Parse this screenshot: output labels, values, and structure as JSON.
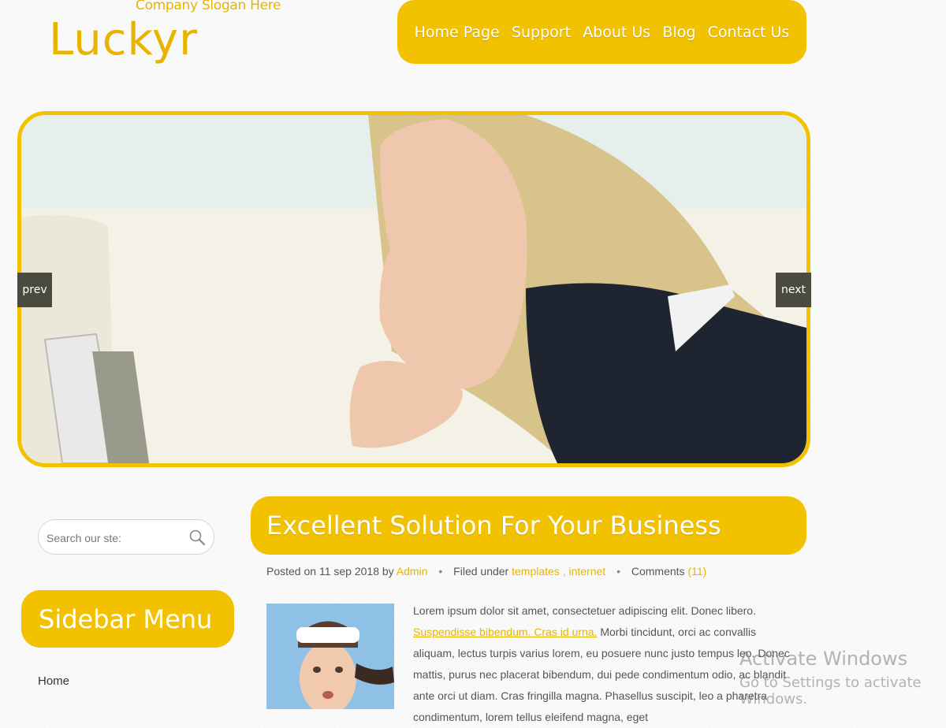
{
  "brand": {
    "slogan": "Company Slogan Here",
    "logo": "Luckyr"
  },
  "nav": {
    "items": [
      "Home Page",
      "Support",
      "About Us",
      "Blog",
      "Contact Us"
    ]
  },
  "slider": {
    "prev_label": "prev",
    "next_label": "next"
  },
  "search": {
    "placeholder": "Search our ste:",
    "icon": "search-icon"
  },
  "sidebar": {
    "title": "Sidebar Menu",
    "items": [
      "Home"
    ]
  },
  "post": {
    "title": "Excellent Solution For Your Business",
    "meta": {
      "posted_on": "Posted on",
      "date": "11 sep 2018",
      "by": "by",
      "author": "Admin",
      "filed_under": "Filed under",
      "tag1": "templates",
      "tag_sep": ",",
      "tag2": "internet",
      "comments_label": "Comments",
      "comments_count": "(11)"
    },
    "body_start": "Lorem ipsum dolor sit amet, consectetuer adipiscing elit. Donec libero.",
    "body_link": "Suspendisse bibendum. Cras id urna.",
    "body_rest": "Morbi tincidunt, orci ac convallis aliquam, lectus turpis varius lorem, eu posuere nunc justo tempus leo. Donec mattis, purus nec placerat bibendum, dui pede condimentum odio, ac blandit ante orci ut diam. Cras fringilla magna. Phasellus suscipit, leo a pharetra condimentum, lorem tellus eleifend magna, eget"
  },
  "watermark": {
    "line1": "Activate Windows",
    "line2": "Go to Settings to activate Windows."
  },
  "colors": {
    "accent": "#f2c200",
    "text": "#555555",
    "slider_button": "#4a4a40"
  }
}
